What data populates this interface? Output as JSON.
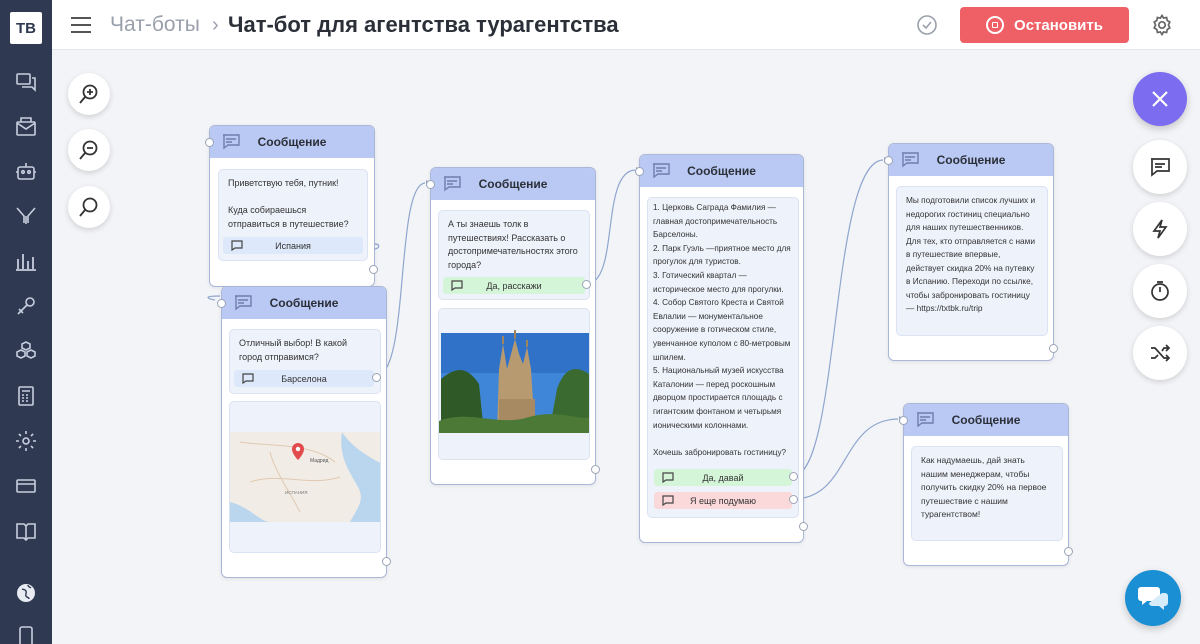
{
  "header": {
    "breadcrumb": "Чат-боты",
    "title": "Чат-бот для агентства турагентства",
    "stop_label": "Остановить"
  },
  "logo": "TB",
  "colors": {
    "accent": "#7b6cf0",
    "stop": "#ef5f66",
    "card_head": "#b9c9f4",
    "chat": "#1a8fd3"
  },
  "cards": {
    "c1": {
      "title": "Сообщение",
      "text": "Приветствую тебя, путник!\n\nКуда собираешься отправиться в путешествие?",
      "button": "Испания"
    },
    "c2": {
      "title": "Сообщение",
      "text": "Отличный выбор! В какой город отправимся?",
      "button": "Барселона"
    },
    "c3": {
      "title": "Сообщение",
      "text": "А ты знаешь толк в путешествиях! Рассказать о достопримечательностях этого города?",
      "button": "Да, расскажи"
    },
    "c4": {
      "title": "Сообщение",
      "text": "1. Церковь Саграда Фамилия — главная достопримечательность Барселоны.\n2. Парк Гуэль —приятное место для прогулок для туристов.\n3. Готический квартал — историческое место для прогулки.\n4. Собор Святого Креста и Святой Евлалии —  монументальное сооружение в готическом стиле, увенчанное куполом с 80-метровым шпилем.\n5. Национальный музей искусства Каталонии — перед роскошным дворцом простирается площадь с гигантским фонтаном и четырьмя ионическими колоннами.\n\nХочешь забронировать гостиницу?",
      "button_yes": "Да, давай",
      "button_no": "Я еще подумаю"
    },
    "c5": {
      "title": "Сообщение",
      "text": "Мы подготовили список лучших и недорогих гостиниц специально для наших путешественников. Для тех, кто отправляется с нами в путешествие впервые, действует скидка 20% на путевку в Испанию. Переходи по ссылке, чтобы забронировать гостиницу — https://txtbk.ru/trip"
    },
    "c6": {
      "title": "Сообщение",
      "text": "Как надумаешь, дай знать нашим менеджерам, чтобы получить скидку 20% на первое путешествие с нашим турагентством!"
    }
  },
  "map_labels": {
    "city": "Мадрид",
    "country": "ИСПАНИЯ"
  }
}
